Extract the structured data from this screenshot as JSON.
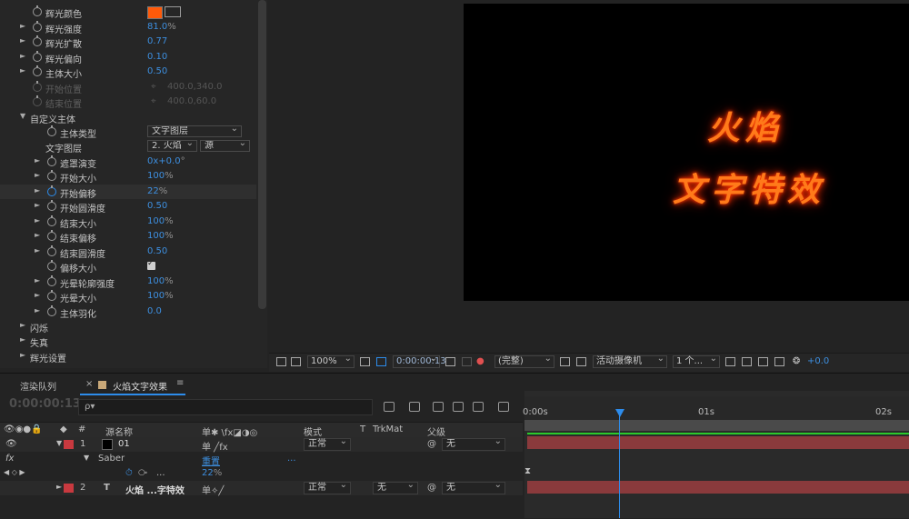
{
  "effects": {
    "rows": [
      {
        "label": "辉光颜色",
        "type": "color",
        "color": "#ff5a0a"
      },
      {
        "label": "辉光强度",
        "value": "81.0",
        "unit": "%"
      },
      {
        "label": "辉光扩散",
        "value": "0.77"
      },
      {
        "label": "辉光偏向",
        "value": "0.10"
      },
      {
        "label": "主体大小",
        "value": "0.50"
      },
      {
        "label": "开始位置",
        "dim_value": "400.0,340.0"
      },
      {
        "label": "结束位置",
        "dim_value": "400.0,60.0"
      },
      {
        "label": "自定义主体"
      },
      {
        "label": "主体类型",
        "dropdown": "文字图层"
      },
      {
        "label": "文字图层",
        "dd_num": "2.",
        "dd_layer": "火焰",
        "dd_src": "源"
      },
      {
        "label": "遮罩演变",
        "value": "0x",
        "value2": "+0.0",
        "unit": "°"
      },
      {
        "label": "开始大小",
        "value": "100",
        "unit": "%"
      },
      {
        "label": "开始偏移",
        "value": "22",
        "unit": "%"
      },
      {
        "label": "开始圆滑度",
        "value": "0.50"
      },
      {
        "label": "结束大小",
        "value": "100",
        "unit": "%"
      },
      {
        "label": "结束偏移",
        "value": "100",
        "unit": "%"
      },
      {
        "label": "结束圆滑度",
        "value": "0.50"
      },
      {
        "label": "偏移大小",
        "type": "checkbox"
      },
      {
        "label": "光晕轮廓强度",
        "value": "100",
        "unit": "%"
      },
      {
        "label": "光晕大小",
        "value": "100",
        "unit": "%"
      },
      {
        "label": "主体羽化",
        "value": "0.0"
      },
      {
        "label": "闪烁"
      },
      {
        "label": "失真"
      },
      {
        "label": "辉光设置"
      }
    ]
  },
  "comp": {
    "line1": "火焰",
    "line2": "文字特效"
  },
  "viewer_bar": {
    "zoom": "100%",
    "timecode": "0:00:00:13",
    "resolution": "(完整)",
    "camera": "活动摄像机",
    "views": "1 个...",
    "exposure": "+0.0"
  },
  "timeline": {
    "tab_render": "渲染队列",
    "tab_comp": "火焰文字效果",
    "timecode": "0:00:00:13",
    "search_placeholder": "ρ▾",
    "headers": {
      "source_name": "源名称",
      "mode": "模式",
      "t": "T",
      "trkmat": "TrkMat",
      "parent": "父级"
    },
    "layer1": {
      "num": "1",
      "name": "01",
      "mode": "正常",
      "parent": "无"
    },
    "fx_row": {
      "effect": "Saber",
      "reset": "重置",
      "dots": "..."
    },
    "prop_row": {
      "value": "22",
      "unit": "%",
      "dots": "..."
    },
    "layer2": {
      "num": "2",
      "type": "T",
      "name": "火焰 ...字特效",
      "mode": "正常",
      "trkmat": "无",
      "parent": "无"
    },
    "ruler": {
      "t0": "0:00s",
      "t1": "01s",
      "t2": "02s"
    }
  }
}
